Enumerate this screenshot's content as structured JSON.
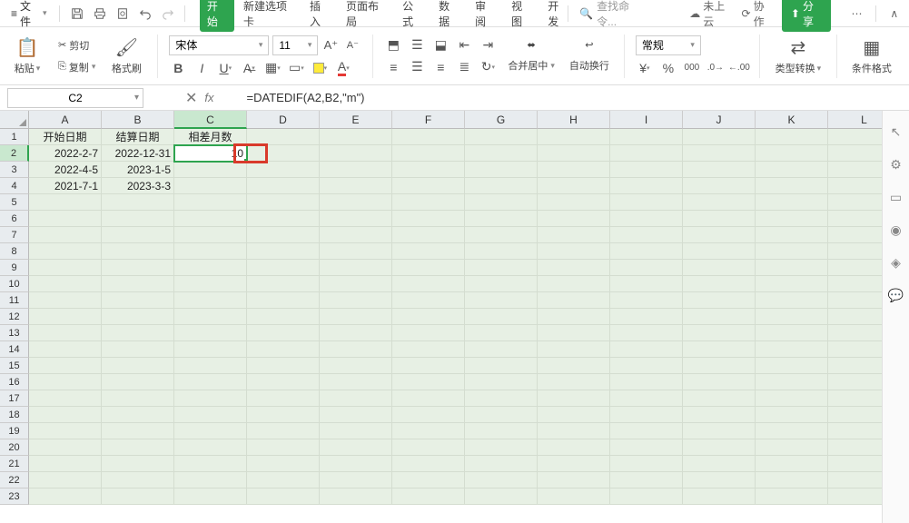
{
  "topbar": {
    "file_label": "文件",
    "tabs": [
      "开始",
      "新建选项卡",
      "插入",
      "页面布局",
      "公式",
      "数据",
      "审阅",
      "视图",
      "开发"
    ],
    "active_tab_index": 0,
    "search_placeholder": "查找命令...",
    "cloud_label": "未上云",
    "collab_label": "协作",
    "share_label": "分享"
  },
  "ribbon": {
    "paste_label": "粘贴",
    "cut_label": "剪切",
    "copy_label": "复制",
    "format_painter_label": "格式刷",
    "font_name": "宋体",
    "font_size": "11",
    "merge_label": "合并居中",
    "wrap_label": "自动换行",
    "number_format": "常规",
    "type_convert_label": "类型转换",
    "cond_format_label": "条件格式"
  },
  "formula_bar": {
    "cell_ref": "C2",
    "formula": "=DATEDIF(A2,B2,\"m\")"
  },
  "sheet": {
    "columns": [
      "A",
      "B",
      "C",
      "D",
      "E",
      "F",
      "G",
      "H",
      "I",
      "J",
      "K",
      "L"
    ],
    "row_count": 23,
    "selected_cell": {
      "row": 2,
      "col": "C"
    },
    "data": {
      "headers": [
        "开始日期",
        "结算日期",
        "相差月数"
      ],
      "rows": [
        {
          "a": "2022-2-7",
          "b": "2022-12-31",
          "c": "10"
        },
        {
          "a": "2022-4-5",
          "b": "2023-1-5",
          "c": ""
        },
        {
          "a": "2021-7-1",
          "b": "2023-3-3",
          "c": ""
        }
      ]
    }
  }
}
